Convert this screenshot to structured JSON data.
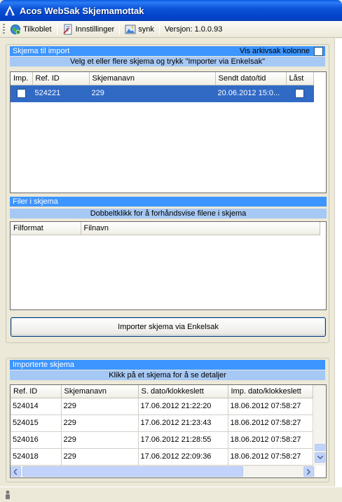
{
  "window": {
    "title": "Acos WebSak Skjemamottak"
  },
  "toolbar": {
    "status_label": "Tilkoblet",
    "settings_label": "Innstillinger",
    "sync_label": "synk",
    "version_label": "Versjon:",
    "version_value": "1.0.0.93"
  },
  "schemas": {
    "header": "Skjema til import",
    "archive_toggle_label": "Vis arkivsak kolonne",
    "instruction": "Velg et eller flere skjema og trykk \"Importer via Enkelsak\"",
    "columns": [
      "Imp.",
      "Ref. ID",
      "Skjemanavn",
      "Sendt dato/tid",
      "Låst"
    ],
    "rows": [
      {
        "ref_id": "524221",
        "name": "229",
        "sent": "20.06.2012 15:0..."
      }
    ]
  },
  "files": {
    "header": "Filer i skjema",
    "instruction": "Dobbeltklikk for å forhåndsvise filene i skjema",
    "columns": [
      "Filformat",
      "Filnavn"
    ]
  },
  "import_button_label": "Importer skjema via Enkelsak",
  "imported": {
    "header": "Importerte skjema",
    "instruction": "Klikk på et skjema for å se detaljer",
    "columns": [
      "Ref. ID",
      "Skjemanavn",
      "S. dato/klokkeslett",
      "Imp. dato/klokkeslett"
    ],
    "rows": [
      {
        "ref_id": "524014",
        "name": "229",
        "sent": "17.06.2012 21:22:20",
        "imported": "18.06.2012 07:58:27"
      },
      {
        "ref_id": "524015",
        "name": "229",
        "sent": "17.06.2012 21:23:43",
        "imported": "18.06.2012 07:58:27"
      },
      {
        "ref_id": "524016",
        "name": "229",
        "sent": "17.06.2012 21:28:55",
        "imported": "18.06.2012 07:58:27"
      },
      {
        "ref_id": "524018",
        "name": "229",
        "sent": "17.06.2012 22:09:36",
        "imported": "18.06.2012 07:58:27"
      }
    ]
  },
  "icons": {
    "app": "acos-logo-icon",
    "status": "globe-connected-icon",
    "settings": "settings-document-icon",
    "sync": "sync-image-icon",
    "statusbar": "person-icon"
  },
  "colors": {
    "panel_header": "#3d95ff",
    "instruction_bar": "#a6c8f5",
    "selection": "#316ac5",
    "titlebar": "#0c54d8"
  }
}
